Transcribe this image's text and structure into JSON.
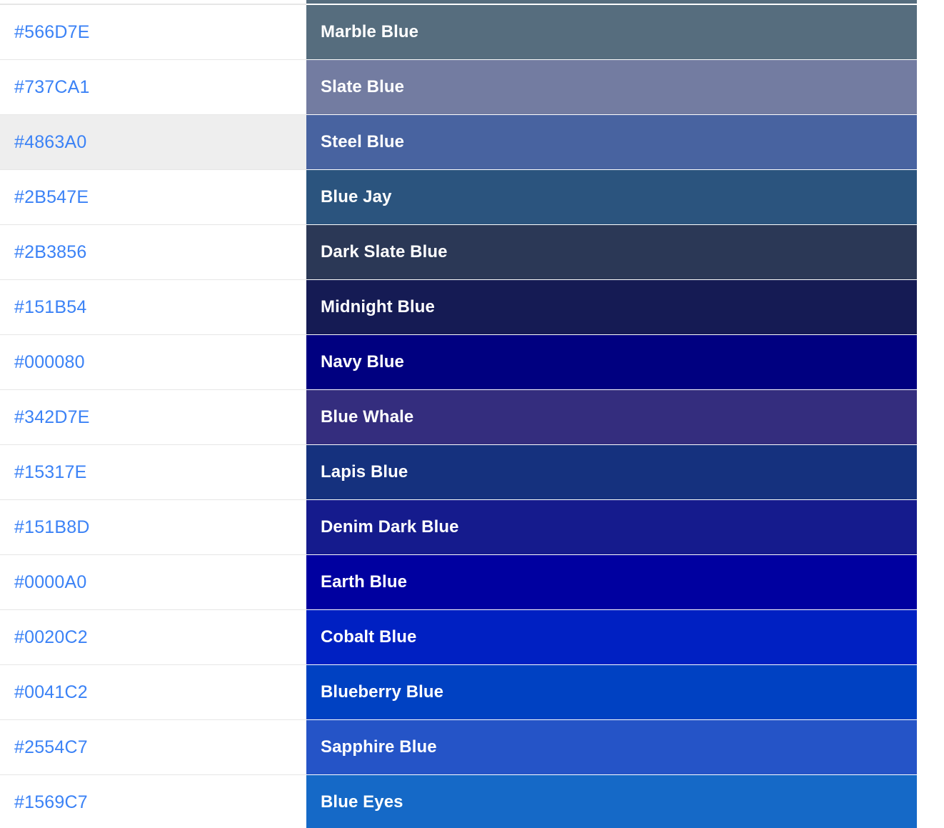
{
  "page": {
    "background": "#ffffff",
    "hex_text_color": "#3b82f6",
    "name_text_color": "#ffffff",
    "row_divider_color": "#e6e6e6",
    "highlight_row_background": "#eeeeee",
    "top_partial_swatch_color": "#566d7e"
  },
  "table": {
    "rows": [
      {
        "hex": "#566D7E",
        "name": "Marble Blue",
        "swatch": "#566D7E",
        "highlighted": false
      },
      {
        "hex": "#737CA1",
        "name": "Slate Blue",
        "swatch": "#737CA1",
        "highlighted": false
      },
      {
        "hex": "#4863A0",
        "name": "Steel Blue",
        "swatch": "#4863A0",
        "highlighted": true
      },
      {
        "hex": "#2B547E",
        "name": "Blue Jay",
        "swatch": "#2B547E",
        "highlighted": false
      },
      {
        "hex": "#2B3856",
        "name": "Dark Slate Blue",
        "swatch": "#2B3856",
        "highlighted": false
      },
      {
        "hex": "#151B54",
        "name": "Midnight Blue",
        "swatch": "#151B54",
        "highlighted": false
      },
      {
        "hex": "#000080",
        "name": "Navy Blue",
        "swatch": "#000080",
        "highlighted": false
      },
      {
        "hex": "#342D7E",
        "name": "Blue Whale",
        "swatch": "#342D7E",
        "highlighted": false
      },
      {
        "hex": "#15317E",
        "name": "Lapis Blue",
        "swatch": "#15317E",
        "highlighted": false
      },
      {
        "hex": "#151B8D",
        "name": "Denim Dark Blue",
        "swatch": "#151B8D",
        "highlighted": false
      },
      {
        "hex": "#0000A0",
        "name": "Earth Blue",
        "swatch": "#0000A0",
        "highlighted": false
      },
      {
        "hex": "#0020C2",
        "name": "Cobalt Blue",
        "swatch": "#0020C2",
        "highlighted": false
      },
      {
        "hex": "#0041C2",
        "name": "Blueberry Blue",
        "swatch": "#0041C2",
        "highlighted": false
      },
      {
        "hex": "#2554C7",
        "name": "Sapphire Blue",
        "swatch": "#2554C7",
        "highlighted": false
      },
      {
        "hex": "#1569C7",
        "name": "Blue Eyes",
        "swatch": "#1569C7",
        "highlighted": false
      }
    ]
  }
}
